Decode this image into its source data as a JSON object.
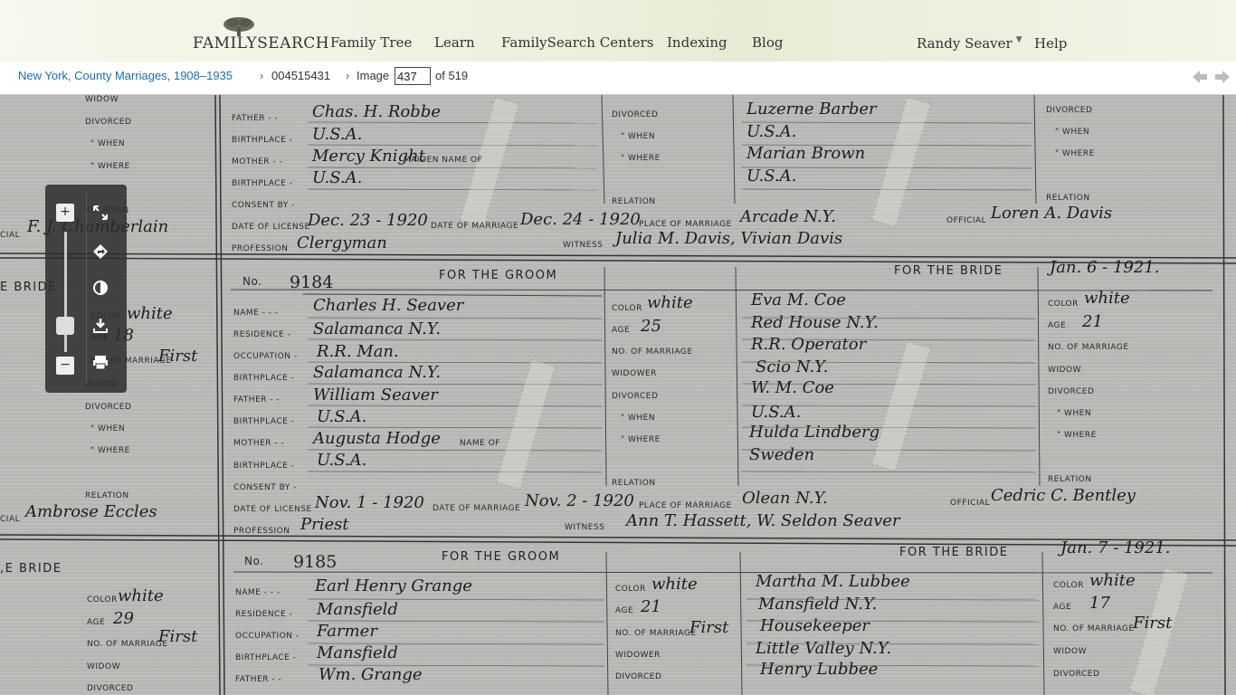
{
  "header": {
    "logo_text": "FAMILYSEARCH",
    "nav": [
      "Family Tree",
      "Learn",
      "FamilySearch Centers",
      "Indexing",
      "Blog"
    ],
    "user_name": "Randy Seaver",
    "help_label": "Help"
  },
  "breadcrumb": {
    "collection": "New York, County Marriages, 1908–1935",
    "separator": "›",
    "film_id": "004515431",
    "image_label": "Image",
    "image_number": "437",
    "of_total": "of 519"
  },
  "tools": {
    "zoom_in": "+",
    "zoom_out": "−"
  },
  "document": {
    "labels": {
      "widow": "WIDOW",
      "divorced": "DIVORCED",
      "when": "\" WHEN",
      "where": "\" WHERE",
      "relation": "RELATION",
      "father": "FATHER - -",
      "birthplace": "BIRTHPLACE -",
      "mother": "MOTHER - -",
      "consent": "CONSENT BY -",
      "date_license": "DATE OF LICENSE",
      "date_marriage": "DATE OF MARRIAGE",
      "place_marriage": "PLACE OF MARRIAGE",
      "official": "OFFICIAL",
      "profession": "PROFESSION",
      "witness": "WITNESS",
      "no": "No.",
      "for_groom": "FOR THE GROOM",
      "for_bride": "FOR THE BRIDE",
      "bride_partial": "E BRIDE",
      "bride_partial2": ",E BRIDE",
      "name": "NAME - - -",
      "residence": "RESIDENCE -",
      "occupation": "OCCUPATION -",
      "color": "COLOR",
      "age": "AGE",
      "no_marriage": "NO. OF MARRIAGE",
      "widower": "WIDOWER",
      "name_of": "NAME OF",
      "maiden_name_of": "MAIDEN NAME OF",
      "cial": "CIAL"
    },
    "top": {
      "father": "Chas. H. Robbe",
      "birthplace1": "U.S.A.",
      "mother": "Mercy Knight",
      "birthplace2": "U.S.A.",
      "bride_divorced": "Luzerne Barber",
      "bride_when": "U.S.A.",
      "bride_where": "Marian Brown",
      "bride_extra": "U.S.A.",
      "official_left": "F. J. Chamberlain",
      "license": "Dec. 23 - 1920",
      "marriage": "Dec. 24 - 1920",
      "place": "Arcade N.Y.",
      "official": "Loren A. Davis",
      "profession": "Clergyman",
      "witness": "Julia M. Davis, Vivian Davis"
    },
    "r9184": {
      "number": "9184",
      "date": "Jan. 6 - 1921.",
      "groom_name": "Charles H. Seaver",
      "groom_residence": "Salamanca N.Y.",
      "groom_occupation": "R.R. Man.",
      "groom_birthplace": "Salamanca N.Y.",
      "groom_father": "William Seaver",
      "groom_fbirth": "U.S.A.",
      "groom_mother": "Augusta Hodge",
      "groom_mbirth": "U.S.A.",
      "groom_color": "white",
      "groom_age": "25",
      "bride_name": "Eva M. Coe",
      "bride_residence": "Red House N.Y.",
      "bride_occupation": "R.R. Operator",
      "bride_birthplace": "Scio N.Y.",
      "bride_father": "W. M. Coe",
      "bride_fbirth": "U.S.A.",
      "bride_mother": "Hulda Lindberg",
      "bride_mbirth": "Sweden",
      "bride_color": "white",
      "bride_age": "21",
      "left_color": "white",
      "left_age": "18",
      "left_marr": "First",
      "official_left": "Ambrose Eccles",
      "license": "Nov. 1 - 1920",
      "marriage": "Nov. 2 - 1920",
      "place": "Olean N.Y.",
      "official": "Cedric C. Bentley",
      "profession": "Priest",
      "witness": "Ann T. Hassett, W. Seldon Seaver"
    },
    "r9185": {
      "number": "9185",
      "date": "Jan. 7 - 1921.",
      "groom_name": "Earl Henry Grange",
      "groom_residence": "Mansfield",
      "groom_occupation": "Farmer",
      "groom_birthplace": "Mansfield",
      "groom_father": "Wm. Grange",
      "groom_color": "white",
      "groom_age": "21",
      "groom_marr": "First",
      "bride_name": "Martha M. Lubbee",
      "bride_residence": "Mansfield N.Y.",
      "bride_occupation": "Housekeeper",
      "bride_birthplace": "Little Valley N.Y.",
      "bride_father": "Henry Lubbee",
      "bride_color": "white",
      "bride_age": "17",
      "bride_marr": "First",
      "left_color": "white",
      "left_age": "29",
      "left_marr": "First"
    }
  }
}
